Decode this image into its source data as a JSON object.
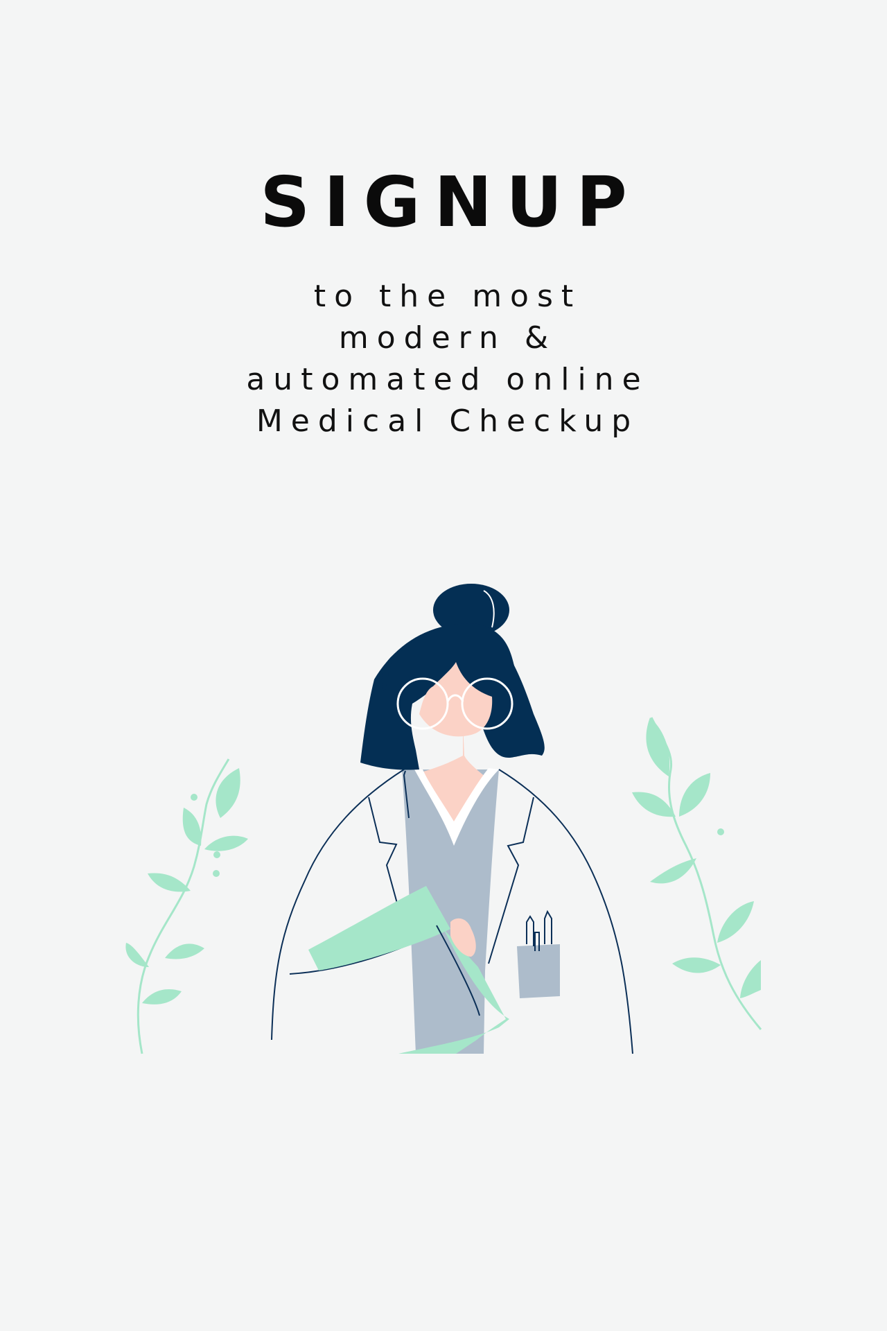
{
  "title": "SIGNUP",
  "subtitle": {
    "lines": [
      "to the most",
      "modern &",
      "automated online",
      "Medical Checkup"
    ]
  },
  "illustration": {
    "icon": "doctor-illustration",
    "colors": {
      "background": "#f4f5f5",
      "hair": "#042f54",
      "skin": "#fbd2c6",
      "leaf": "#a5e6c9",
      "scrubs": "#adbccb",
      "outline": "#0b2f57"
    }
  }
}
